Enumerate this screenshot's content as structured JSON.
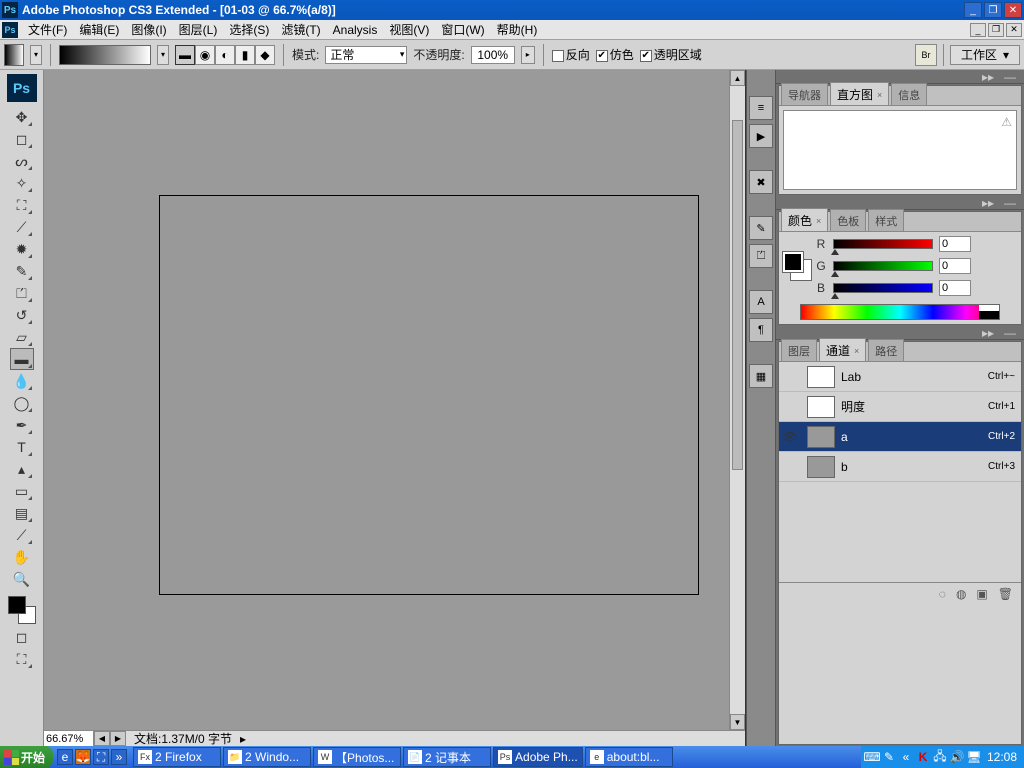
{
  "titlebar": {
    "title": "Adobe Photoshop CS3 Extended - [01-03 @ 66.7%(a/8)]"
  },
  "menubar": {
    "items": [
      {
        "label": "文件(F)"
      },
      {
        "label": "编辑(E)"
      },
      {
        "label": "图像(I)"
      },
      {
        "label": "图层(L)"
      },
      {
        "label": "选择(S)"
      },
      {
        "label": "滤镜(T)"
      },
      {
        "label": "Analysis"
      },
      {
        "label": "视图(V)"
      },
      {
        "label": "窗口(W)"
      },
      {
        "label": "帮助(H)"
      }
    ]
  },
  "options": {
    "mode_label": "模式:",
    "mode_value": "正常",
    "opacity_label": "不透明度:",
    "opacity_value": "100%",
    "reverse": {
      "label": "反向",
      "checked": false
    },
    "dither": {
      "label": "仿色",
      "checked": true
    },
    "transparency": {
      "label": "透明区域",
      "checked": true
    },
    "workspace": "工作区"
  },
  "panels": {
    "nav": {
      "tabs": [
        "导航器",
        "直方图",
        "信息"
      ],
      "active": 1
    },
    "color": {
      "tabs": [
        "颜色",
        "色板",
        "样式"
      ],
      "active": 0,
      "r": {
        "label": "R",
        "value": "0"
      },
      "g": {
        "label": "G",
        "value": "0"
      },
      "b": {
        "label": "B",
        "value": "0"
      }
    },
    "channels": {
      "tabs": [
        "图层",
        "通道",
        "路径"
      ],
      "active": 1,
      "rows": [
        {
          "name": "Lab",
          "shortcut": "Ctrl+~",
          "sel": false,
          "eye": false,
          "color": "#ffffff"
        },
        {
          "name": "明度",
          "shortcut": "Ctrl+1",
          "sel": false,
          "eye": false,
          "color": "#ffffff"
        },
        {
          "name": "a",
          "shortcut": "Ctrl+2",
          "sel": true,
          "eye": true,
          "color": "#999999"
        },
        {
          "name": "b",
          "shortcut": "Ctrl+3",
          "sel": false,
          "eye": false,
          "color": "#999999"
        }
      ]
    }
  },
  "status": {
    "zoom": "66.67%",
    "doc": "文档:1.37M/0 字节"
  },
  "taskbar": {
    "start": "开始",
    "tasks": [
      {
        "label": "2 Firefox",
        "ic": "Fx"
      },
      {
        "label": "2 Windo...",
        "ic": "📁"
      },
      {
        "label": "【Photos...",
        "ic": "W"
      },
      {
        "label": "2 记事本",
        "ic": "📄"
      },
      {
        "label": "Adobe Ph...",
        "ic": "Ps",
        "active": true
      },
      {
        "label": "about:bl...",
        "ic": "e"
      }
    ],
    "clock": "12:08"
  }
}
